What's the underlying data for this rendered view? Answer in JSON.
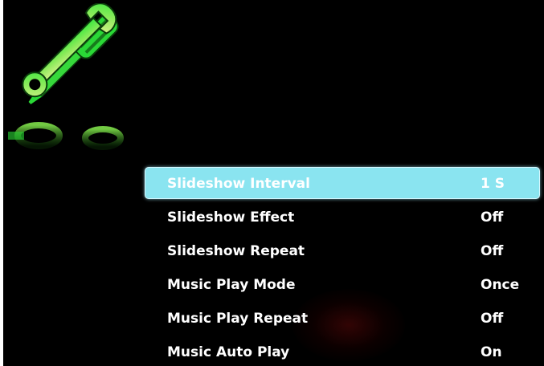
{
  "icon": "wrench-screwdriver-icon",
  "colors": {
    "background": "#000000",
    "highlight": "#8ae4f0",
    "text": "#ffffff",
    "icon_green": "#2ee33a",
    "icon_lime": "#c8f078"
  },
  "menu": {
    "items": [
      {
        "label": "Slideshow Interval",
        "value": "1 S",
        "selected": true
      },
      {
        "label": "Slideshow Effect",
        "value": "Off",
        "selected": false
      },
      {
        "label": "Slideshow Repeat",
        "value": "Off",
        "selected": false
      },
      {
        "label": "Music Play Mode",
        "value": "Once",
        "selected": false
      },
      {
        "label": "Music Play Repeat",
        "value": "Off",
        "selected": false
      },
      {
        "label": "Music Auto Play",
        "value": "On",
        "selected": false
      }
    ]
  }
}
